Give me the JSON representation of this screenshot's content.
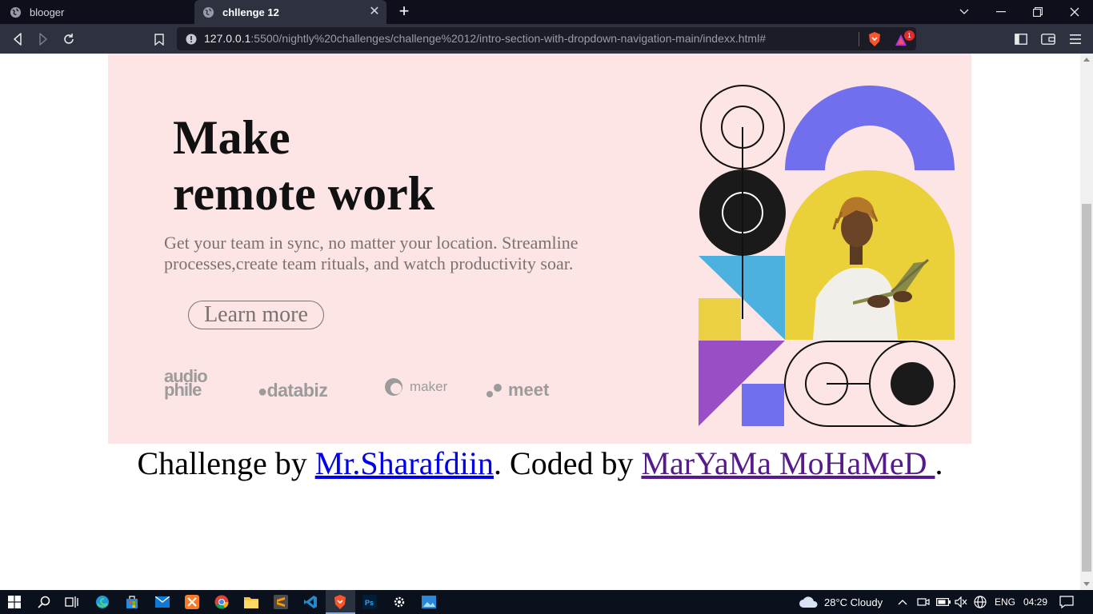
{
  "browser": {
    "tabs": [
      {
        "label": "blooger"
      },
      {
        "label": "chllenge 12"
      }
    ],
    "url_host": "127.0.0.1",
    "url_rest": ":5500/nightly%20challenges/challenge%2012/intro-section-with-dropdown-navigation-main/indexx.html#",
    "rewards_badge": "1"
  },
  "hero": {
    "headline_line1": "Make",
    "headline_line2": "remote work",
    "description": "Get your team in sync, no matter your location. Streamline processes,create team rituals, and watch productivity soar.",
    "cta_label": "Learn more",
    "clients": [
      {
        "line1": "audio",
        "line2": "phile"
      },
      {
        "name": "databiz"
      },
      {
        "name": "maker"
      },
      {
        "name": "meet"
      }
    ]
  },
  "footer": {
    "prefix": "Challenge by ",
    "author1": "Mr.Sharafdiin",
    "middle": ". Coded by ",
    "author2": "MarYaMa MoHaMeD ",
    "suffix": "."
  },
  "taskbar": {
    "weather": "28°C  Cloudy",
    "language": "ENG",
    "time": "04:29"
  },
  "colors": {
    "hero_bg": "#fce5e4",
    "tab_active": "#2e3140",
    "accent_purple": "#726fee",
    "accent_yellow": "#ebd044",
    "accent_blue": "#4cb1de"
  }
}
